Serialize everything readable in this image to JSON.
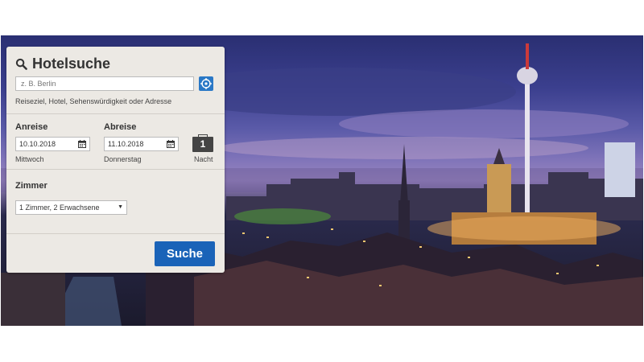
{
  "search": {
    "title": "Hotelsuche",
    "destination_placeholder": "z. B. Berlin",
    "destination_hint": "Reiseziel, Hotel, Sehenswürdigkeit oder Adresse"
  },
  "dates": {
    "checkin_label": "Anreise",
    "checkin_value": "10.10.2018",
    "checkin_day": "Mittwoch",
    "checkout_label": "Abreise",
    "checkout_value": "11.10.2018",
    "checkout_day": "Donnerstag",
    "nights_count": "1",
    "nights_label": "Nacht"
  },
  "rooms": {
    "label": "Zimmer",
    "selected": "1 Zimmer, 2 Erwachsene",
    "arrow": "▼"
  },
  "actions": {
    "search_label": "Suche"
  },
  "colors": {
    "accent": "#1a63b8",
    "panel_bg": "#ece9e4"
  },
  "icons": [
    "search-icon",
    "locate-icon",
    "calendar-icon",
    "briefcase-icon",
    "chevron-down-icon"
  ]
}
